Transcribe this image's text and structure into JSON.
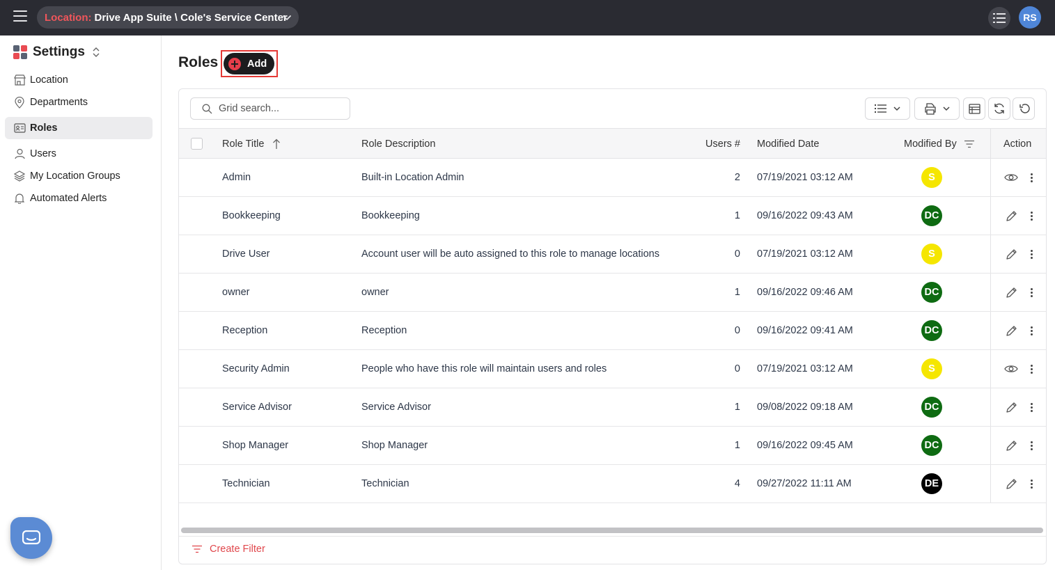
{
  "topbar": {
    "location_label": "Location:",
    "location_value": "Drive App Suite \\ Cole's Service Center",
    "user_initials": "RS"
  },
  "sidebar": {
    "title": "Settings",
    "items": [
      {
        "label": "Location",
        "icon": "store-icon"
      },
      {
        "label": "Departments",
        "icon": "map-pin-icon"
      },
      {
        "label": "Roles",
        "icon": "id-card-icon",
        "active": true
      },
      {
        "label": "Users",
        "icon": "user-icon"
      },
      {
        "label": "My Location Groups",
        "icon": "layers-icon"
      },
      {
        "label": "Automated Alerts",
        "icon": "bell-icon"
      }
    ]
  },
  "page": {
    "title": "Roles",
    "add_label": "Add"
  },
  "grid": {
    "search_placeholder": "Grid search...",
    "columns": {
      "role_title": "Role Title",
      "role_description": "Role Description",
      "users": "Users #",
      "modified_date": "Modified Date",
      "modified_by": "Modified By",
      "action": "Action"
    },
    "rows": [
      {
        "title": "Admin",
        "description": "Built-in Location Admin",
        "users": "2",
        "date": "07/19/2021 03:12 AM",
        "by": "S",
        "action_icon": "eye-icon"
      },
      {
        "title": "Bookkeeping",
        "description": "Bookkeeping",
        "users": "1",
        "date": "09/16/2022 09:43 AM",
        "by": "DC",
        "action_icon": "pencil-icon"
      },
      {
        "title": "Drive User",
        "description": "Account user will be auto assigned to this role to manage locations",
        "users": "0",
        "date": "07/19/2021 03:12 AM",
        "by": "S",
        "action_icon": "pencil-icon"
      },
      {
        "title": "owner",
        "description": "owner",
        "users": "1",
        "date": "09/16/2022 09:46 AM",
        "by": "DC",
        "action_icon": "pencil-icon"
      },
      {
        "title": "Reception",
        "description": "Reception",
        "users": "0",
        "date": "09/16/2022 09:41 AM",
        "by": "DC",
        "action_icon": "pencil-icon"
      },
      {
        "title": "Security Admin",
        "description": "People who have this role will maintain users and roles",
        "users": "0",
        "date": "07/19/2021 03:12 AM",
        "by": "S",
        "action_icon": "eye-icon"
      },
      {
        "title": "Service Advisor",
        "description": "Service Advisor",
        "users": "1",
        "date": "09/08/2022 09:18 AM",
        "by": "DC",
        "action_icon": "pencil-icon"
      },
      {
        "title": "Shop Manager",
        "description": "Shop Manager",
        "users": "1",
        "date": "09/16/2022 09:45 AM",
        "by": "DC",
        "action_icon": "pencil-icon"
      },
      {
        "title": "Technician",
        "description": "Technician",
        "users": "4",
        "date": "09/27/2022 11:11 AM",
        "by": "DE",
        "action_icon": "pencil-icon"
      }
    ],
    "create_filter_label": "Create Filter"
  },
  "colors": {
    "topbar_bg": "#2a2b32",
    "location_label": "#f0565b",
    "avatar_S": "#f5e600",
    "avatar_DC": "#0e6b12",
    "avatar_DE": "#000000",
    "accent_red": "#e0474c"
  }
}
